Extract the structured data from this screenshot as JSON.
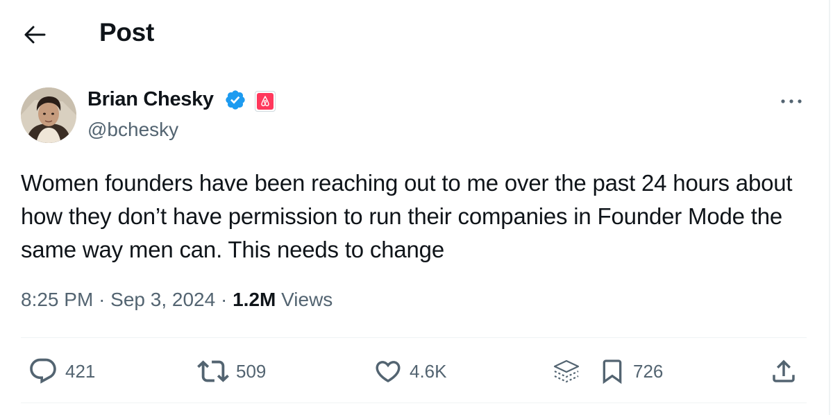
{
  "header": {
    "title": "Post",
    "back_icon": "arrow-left-icon"
  },
  "author": {
    "name": "Brian Chesky",
    "handle": "@bchesky",
    "verified_icon": "verified-badge-icon",
    "affiliation_icon": "airbnb-logo-icon",
    "verified_color": "#1d9bf0",
    "affiliation_color": "#ff385c"
  },
  "tweet": {
    "text": "Women founders have been reaching out to me over the past 24 hours about how they don’t have permission to run their companies in Founder Mode the same way men can. This needs to change",
    "time": "8:25 PM",
    "separator": "·",
    "date": "Sep 3, 2024",
    "views_count": "1.2M",
    "views_label": "Views"
  },
  "actions": {
    "reply": {
      "icon": "reply-icon",
      "count": "421"
    },
    "repost": {
      "icon": "repost-icon",
      "count": "509"
    },
    "like": {
      "icon": "heart-icon",
      "count": "4.6K"
    },
    "layers": {
      "icon": "layers-icon"
    },
    "bookmark": {
      "icon": "bookmark-icon",
      "count": "726"
    },
    "share": {
      "icon": "share-icon"
    }
  },
  "colors": {
    "text": "#0f1419",
    "muted": "#536471",
    "divider": "#eff3f4"
  }
}
